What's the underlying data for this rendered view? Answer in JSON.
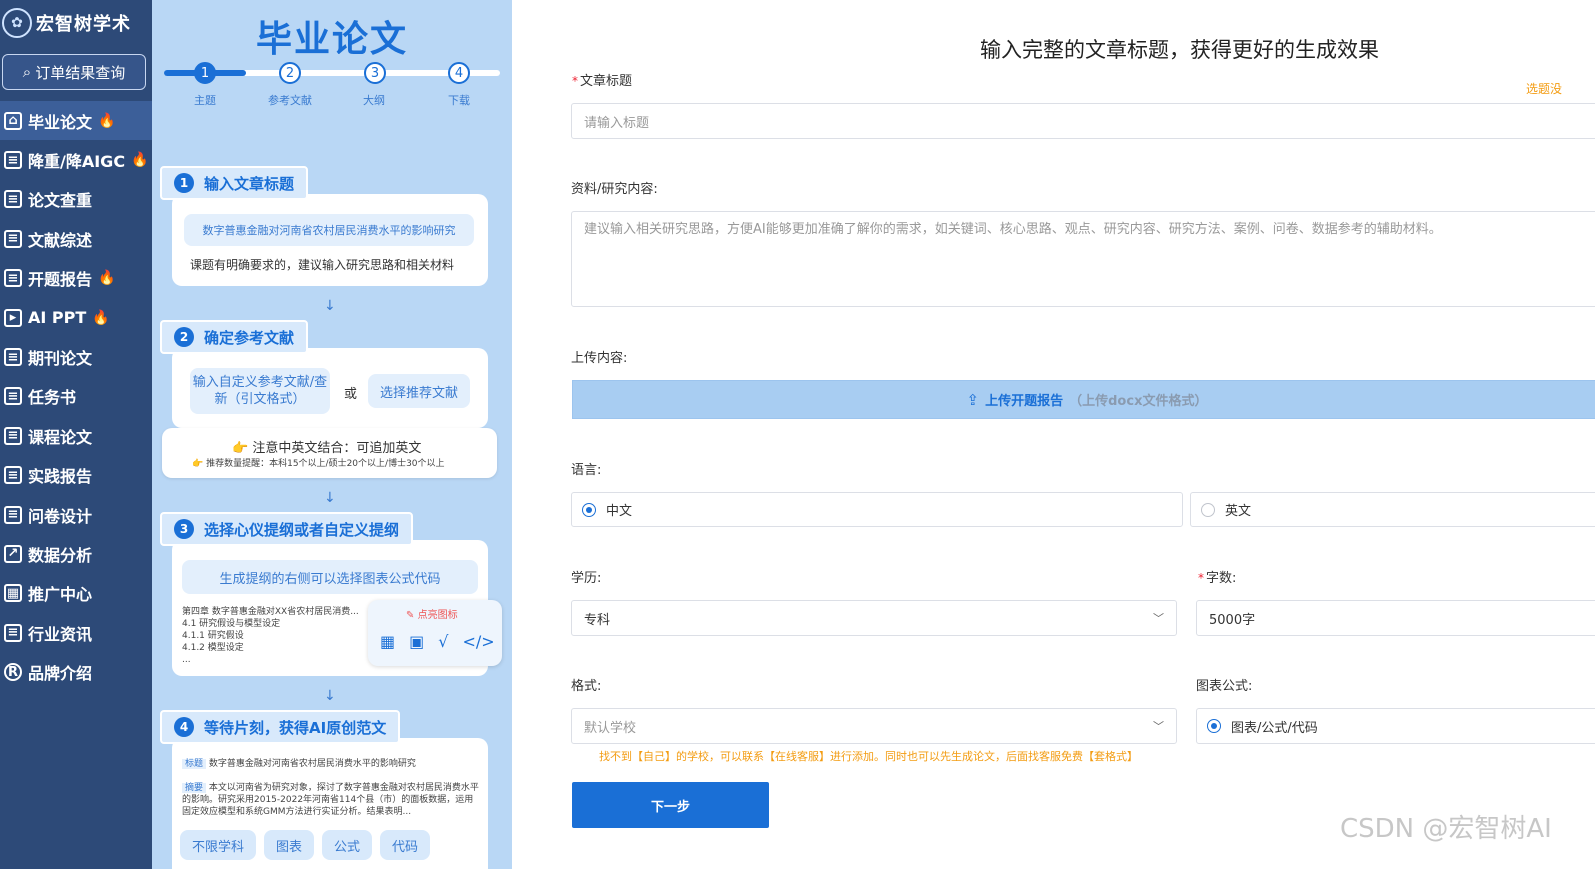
{
  "sidebar": {
    "brand": "宏智树学术",
    "order_button": "订单结果查询",
    "items": [
      {
        "label": "毕业论文",
        "hot": true
      },
      {
        "label": "降重/降AIGC",
        "hot": true
      },
      {
        "label": "论文查重",
        "hot": false
      },
      {
        "label": "文献综述",
        "hot": false
      },
      {
        "label": "开题报告",
        "hot": true
      },
      {
        "label": "AI PPT",
        "hot": true
      },
      {
        "label": "期刊论文",
        "hot": false
      },
      {
        "label": "任务书",
        "hot": false
      },
      {
        "label": "课程论文",
        "hot": false
      },
      {
        "label": "实践报告",
        "hot": false
      },
      {
        "label": "问卷设计",
        "hot": false
      },
      {
        "label": "数据分析",
        "hot": false
      },
      {
        "label": "推广中心",
        "hot": false
      },
      {
        "label": "行业资讯",
        "hot": false
      },
      {
        "label": "品牌介绍",
        "hot": false
      }
    ]
  },
  "guide": {
    "title": "毕业论文",
    "steps": [
      {
        "num": "1",
        "label": "主题"
      },
      {
        "num": "2",
        "label": "参考文献"
      },
      {
        "num": "3",
        "label": "大纲"
      },
      {
        "num": "4",
        "label": "下载"
      }
    ],
    "s1": {
      "num": "1",
      "title": "输入文章标题",
      "example": "数字普惠金融对河南省农村居民消费水平的影响研究",
      "tip": "课题有明确要求的，建议输入研究思路和相关材料"
    },
    "s2": {
      "num": "2",
      "title": "确定参考文献",
      "custom": "输入自定义参考文献/查新（引文格式）",
      "or": "或",
      "recommend": "选择推荐文献",
      "note": "注意中英文结合：可追加英文",
      "note_small": "推荐数量提醒：本科15个以上/硕士20个以上/博士30个以上"
    },
    "s3": {
      "num": "3",
      "title": "选择心仪提纲或者自定义提纲",
      "tip": "生成提纲的右侧可以选择图表公式代码",
      "outline": [
        "第四章 数字普惠金融对XX省农村居民消费...",
        "4.1 研究假设与模型设定",
        "4.1.1 研究假设",
        "4.1.2 模型设定",
        "..."
      ],
      "popup_hint": "点亮图标"
    },
    "s4": {
      "num": "4",
      "title": "等待片刻，获得AI原创范文",
      "tag_title": "标题",
      "paper_title": "数字普惠金融对河南省农村居民消费水平的影响研究",
      "tag_abstract": "摘要",
      "abstract": "本文以河南省为研究对象，探讨了数字普惠金融对农村居民消费水平的影响。研究采用2015-2022年河南省114个县（市）的面板数据，运用固定效应模型和系统GMM方法进行实证分析。结果表明...",
      "tags": [
        "不限学科",
        "图表",
        "公式",
        "代码"
      ]
    }
  },
  "form": {
    "heading": "输入完整的文章标题，获得更好的生成效果",
    "title_label": "文章标题",
    "title_placeholder": "请输入标题",
    "topic_hint": "选题没",
    "material_label": "资料/研究内容:",
    "material_placeholder": "建议输入相关研究思路，方便AI能够更加准确了解你的需求，如关键词、核心思路、观点、研究内容、研究方法、案例、问卷、数据参考的辅助材料。",
    "upload_label": "上传内容:",
    "upload_button": "上传开题报告",
    "upload_sub": "（上传docx文件格式）",
    "lang_label": "语言:",
    "lang_options": [
      "中文",
      "英文"
    ],
    "lang_selected": "中文",
    "edu_label": "学历:",
    "edu_value": "专科",
    "words_label": "字数:",
    "words_value": "5000字",
    "format_label": "格式:",
    "format_placeholder": "默认学校",
    "chart_label": "图表公式:",
    "chart_option": "图表/公式/代码",
    "warn": "找不到【自己】的学校，可以联系【在线客服】进行添加。同时也可以先生成论文，后面找客服免费【套格式】",
    "next_button": "下一步"
  },
  "watermark": "CSDN @宏智树AI",
  "colors": {
    "sidebar_bg": "#2d4a78",
    "guide_bg": "#b9d7f5",
    "primary": "#1a6fd6",
    "warning": "#f39c12"
  }
}
